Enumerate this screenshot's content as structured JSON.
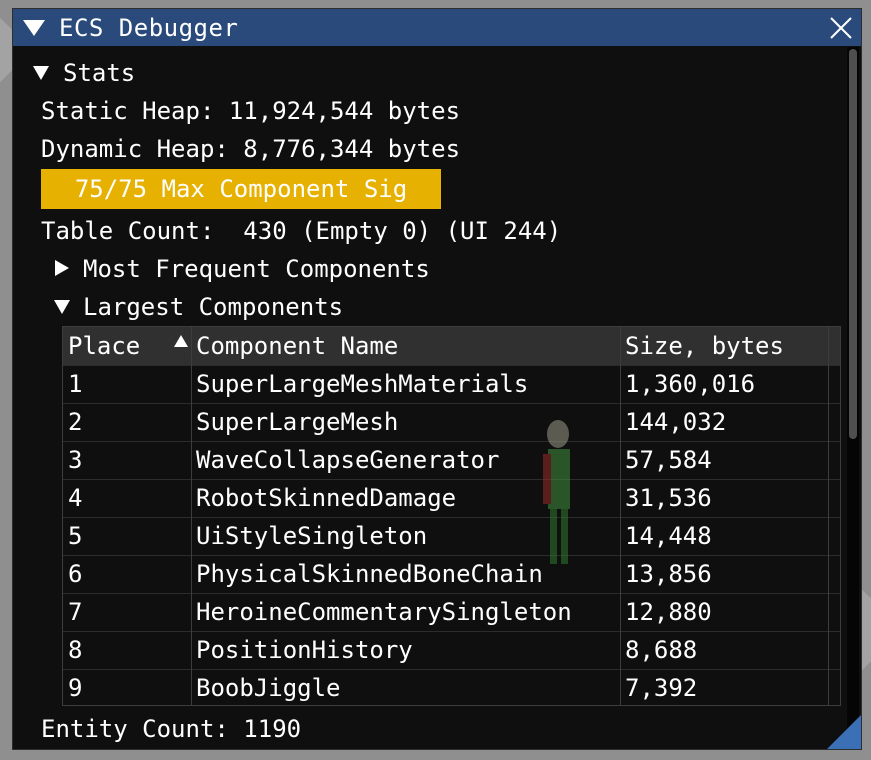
{
  "window": {
    "title": "ECS Debugger",
    "colors": {
      "titlebar": "#294a7a",
      "progress_fill": "#e6b100",
      "resize_grip": "#3b6fb6"
    }
  },
  "stats": {
    "header": "Stats",
    "static_heap": "Static Heap: 11,924,544 bytes",
    "dynamic_heap": "Dynamic Heap: 8,776,344 bytes",
    "component_sig": {
      "label": "75/75 Max Component Sig",
      "value": 75,
      "max": 75
    },
    "table_count": "Table Count:  430 (Empty 0) (UI 244)",
    "most_frequent": "Most Frequent Components",
    "largest": "Largest Components",
    "entity_count": "Entity Count: 1190"
  },
  "largest_table": {
    "columns": [
      "Place",
      "Component Name",
      "Size, bytes"
    ],
    "rows": [
      [
        "1",
        "SuperLargeMeshMaterials",
        "1,360,016"
      ],
      [
        "2",
        "SuperLargeMesh",
        "144,032"
      ],
      [
        "3",
        "WaveCollapseGenerator",
        "57,584"
      ],
      [
        "4",
        "RobotSkinnedDamage",
        "31,536"
      ],
      [
        "5",
        "UiStyleSingleton",
        "14,448"
      ],
      [
        "6",
        "PhysicalSkinnedBoneChain",
        "13,856"
      ],
      [
        "7",
        "HeroineCommentarySingleton",
        "12,880"
      ],
      [
        "8",
        "PositionHistory",
        "8,688"
      ],
      [
        "9",
        "BoobJiggle",
        "7,392"
      ]
    ]
  }
}
